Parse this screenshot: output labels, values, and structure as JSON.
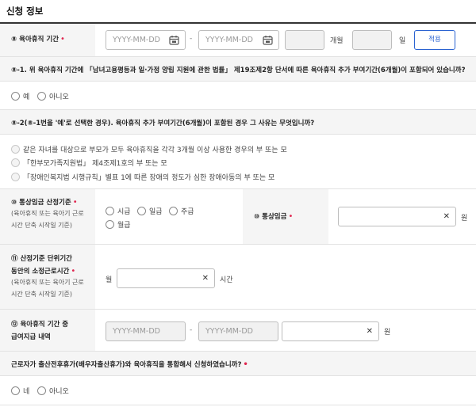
{
  "section_title": "신청 정보",
  "required_mark": "•",
  "row_period": {
    "label": "⑧ 육아휴직 기간",
    "start_placeholder": "YYYY-MM-DD",
    "end_placeholder": "YYYY-MM-DD",
    "dash": "-",
    "months_unit": "개월",
    "days_unit": "일",
    "apply_button": "적용"
  },
  "q1": {
    "question": "⑧-1. 위 육아휴직 기간에 「남녀고용평등과 일·가정 양립 지원에 관한 법률」 제19조제2항 단서에 따른 육아휴직 추가 부여기간(6개월)이 포함되어 있습니까?",
    "options": [
      "예",
      "아니오"
    ]
  },
  "q2": {
    "question": "⑧-2(⑧-1번을 '예'로 선택한 경우). 육아휴직 추가 부여기간(6개월)이 포함된 경우 그 사유는 무엇입니까?",
    "options": [
      "같은 자녀를 대상으로 부모가 모두 육아휴직을 각각 3개월 이상 사용한 경우의 부 또는 모",
      "「한부모가족지원법」 제4조제1호의 부 또는 모",
      "「장애인복지법 시행규칙」별표 1에 따른 장애의 정도가 심한 장애아동의 부 또는 모"
    ]
  },
  "row_wage": {
    "label_title": "⑩ 통상임금 산정기준",
    "label_sub1": "(육아휴직 또는 육아기 근로",
    "label_sub2": "시간 단축 시작일 기준)",
    "options": [
      "시급",
      "일급",
      "주급",
      "월급"
    ],
    "wage_label": "⑩ 통상임금",
    "wage_unit": "원"
  },
  "row_hours": {
    "label_line1": "⑪ 산정기준 단위기간",
    "label_line2": "동안의 소정근로시간",
    "label_sub1": "(육아휴직 또는 육아기 근로",
    "label_sub2": "시간 단축 시작일 기준)",
    "prefix": "월",
    "unit": "시간"
  },
  "row_paid": {
    "label_line1": "⑫ 육아휴직 기간 중",
    "label_line2": "급여지급 내역",
    "start_placeholder": "YYYY-MM-DD",
    "end_placeholder": "YYYY-MM-DD",
    "dash": "-",
    "unit": "원"
  },
  "q3": {
    "question": "근로자가 출산전후휴가(배우자출산휴가)와 육아휴직을 통합해서 신청하였습니까?",
    "options": [
      "네",
      "아니오"
    ]
  },
  "colors": {
    "required": "#e0264f",
    "accent": "#2b63d1"
  }
}
